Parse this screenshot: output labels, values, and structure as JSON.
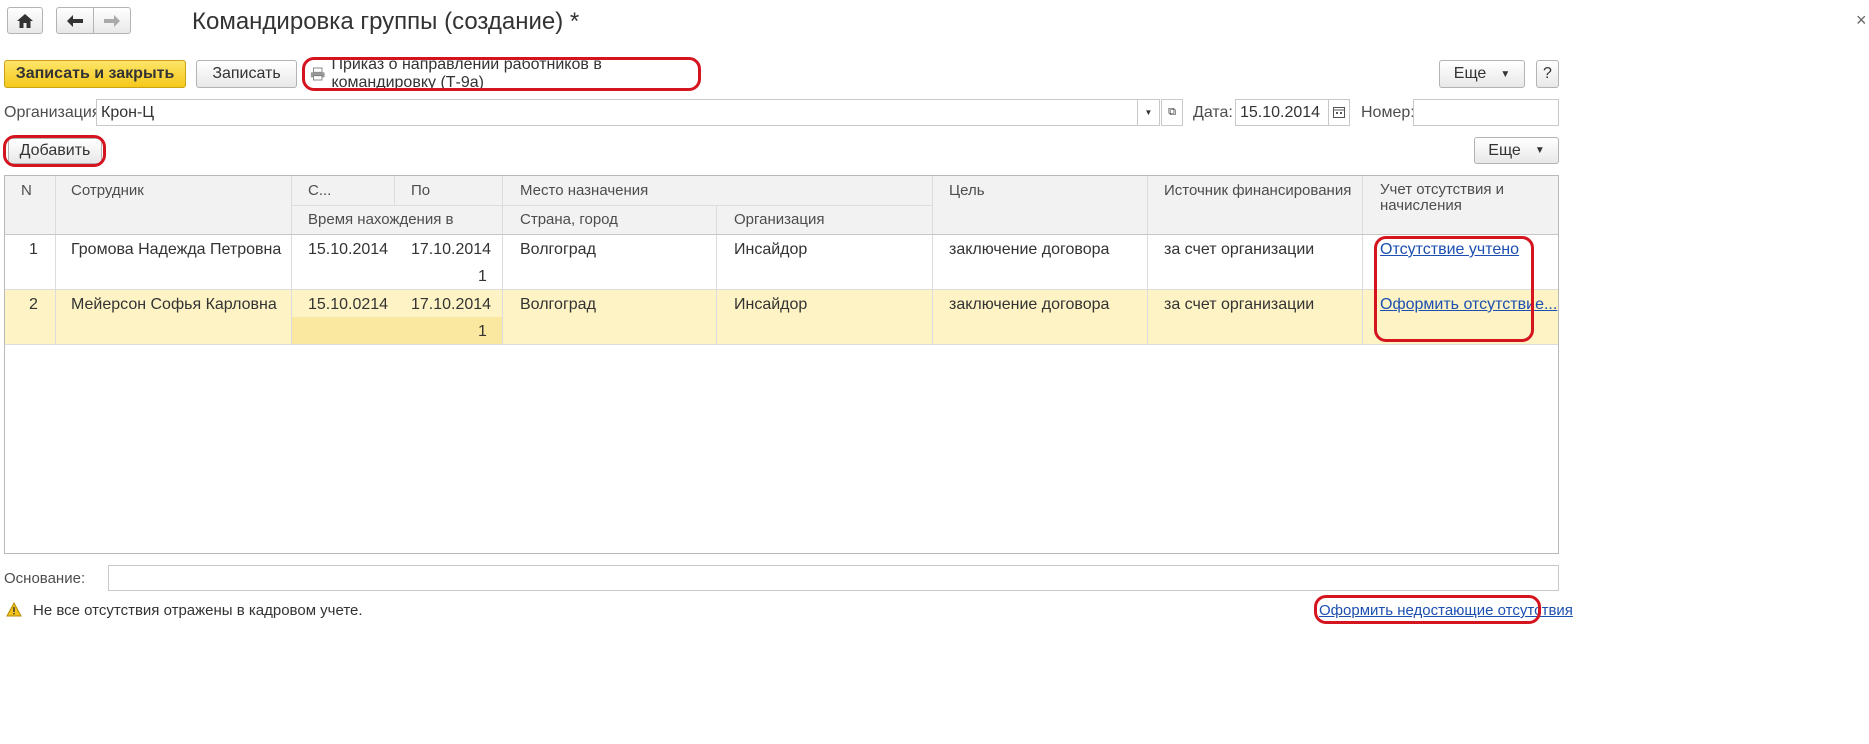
{
  "window": {
    "title": "Командировка группы (создание) *",
    "close_glyph": "×"
  },
  "toolbar": {
    "save_close_label": "Записать и закрыть",
    "save_label": "Записать",
    "print_label": "Приказ о направлении работников в командировку (Т-9а)",
    "more_label": "Еще",
    "help_label": "?"
  },
  "form": {
    "org_label": "Организация:",
    "org_value": "Крон-Ц",
    "date_label": "Дата:",
    "date_value": "15.10.2014",
    "number_label": "Номер:",
    "number_value": ""
  },
  "table_toolbar": {
    "add_label": "Добавить",
    "more_label": "Еще"
  },
  "table": {
    "headers": {
      "n": "N",
      "employee": "Сотрудник",
      "from": "С...",
      "to": "По",
      "days": "Время нахождения в",
      "destination": "Место назначения",
      "country_city": "Страна, город",
      "organization": "Организация",
      "purpose": "Цель",
      "funding": "Источник финансирования",
      "absence": "Учет отсутствия и начисления"
    },
    "rows": [
      {
        "n": "1",
        "employee": "Громова Надежда Петровна",
        "from": "15.10.2014",
        "to": "17.10.2014",
        "days": "1",
        "city": "Волгоград",
        "organization": "Инсайдор",
        "purpose": "заключение договора",
        "funding": "за счет организации",
        "absence": "Отсутствие учтено"
      },
      {
        "n": "2",
        "employee": "Мейерсон Софья Карловна",
        "from": "15.10.0214",
        "to": "17.10.2014",
        "days": "1",
        "city": "Волгоград",
        "organization": "Инсайдор",
        "purpose": "заключение договора",
        "funding": "за счет организации",
        "absence": "Оформить отсутствие..."
      }
    ]
  },
  "footer": {
    "basis_label": "Основание:",
    "basis_value": "",
    "warning_text": "Не все отсутствия отражены в кадровом учете.",
    "fix_link": "Оформить недостающие отсутствия"
  },
  "colors": {
    "accent_yellow": "#f5c81a",
    "highlight_red": "#d4151f",
    "selected_row": "#fdf3c4",
    "link": "#1c4fb0"
  }
}
